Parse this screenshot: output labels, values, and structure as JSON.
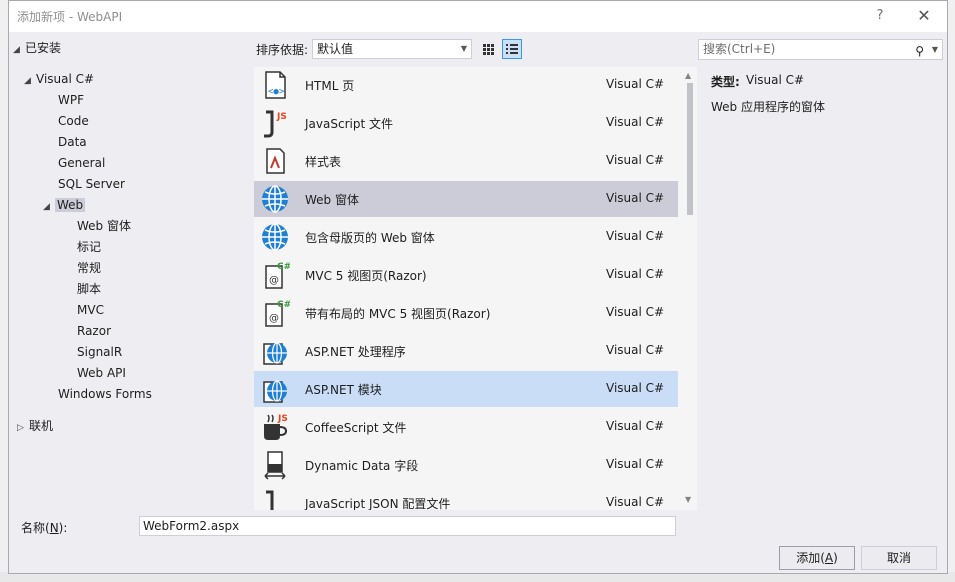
{
  "window": {
    "title": "添加新项 - WebAPI",
    "help_glyph": "?",
    "close_glyph": "✕"
  },
  "tree": {
    "installed": "已安装",
    "visual_csharp": "Visual C#",
    "children": [
      "WPF",
      "Code",
      "Data",
      "General",
      "SQL Server"
    ],
    "web": "Web",
    "web_children": [
      "Web 窗体",
      "标记",
      "常规",
      "脚本",
      "MVC",
      "Razor",
      "SignalR",
      "Web API"
    ],
    "windows_forms": "Windows Forms",
    "online": "联机"
  },
  "toolbar": {
    "sort_label": "排序依据:",
    "sort_value": "默认值"
  },
  "templates": [
    {
      "name": "HTML 页",
      "lang": "Visual C#",
      "icon": "html-page-icon"
    },
    {
      "name": "JavaScript 文件",
      "lang": "Visual C#",
      "icon": "javascript-file-icon"
    },
    {
      "name": "样式表",
      "lang": "Visual C#",
      "icon": "stylesheet-icon"
    },
    {
      "name": "Web 窗体",
      "lang": "Visual C#",
      "icon": "globe-icon"
    },
    {
      "name": "包含母版页的 Web 窗体",
      "lang": "Visual C#",
      "icon": "globe-icon"
    },
    {
      "name": "MVC 5 视图页(Razor)",
      "lang": "Visual C#",
      "icon": "razor-view-icon"
    },
    {
      "name": "带有布局的 MVC 5 视图页(Razor)",
      "lang": "Visual C#",
      "icon": "razor-view-icon"
    },
    {
      "name": "ASP.NET 处理程序",
      "lang": "Visual C#",
      "icon": "globe-doc-icon"
    },
    {
      "name": "ASP.NET 模块",
      "lang": "Visual C#",
      "icon": "globe-doc-icon"
    },
    {
      "name": "CoffeeScript 文件",
      "lang": "Visual C#",
      "icon": "coffeescript-icon"
    },
    {
      "name": "Dynamic Data 字段",
      "lang": "Visual C#",
      "icon": "dynamic-data-icon"
    },
    {
      "name": "JavaScript JSON 配置文件",
      "lang": "Visual C#",
      "icon": "json-config-icon"
    }
  ],
  "search": {
    "placeholder": "搜索(Ctrl+E)"
  },
  "details": {
    "type_label": "类型:",
    "type_value": "Visual C#",
    "description": "Web 应用程序的窗体"
  },
  "name_field": {
    "label_prefix": "名称(",
    "label_key": "N",
    "label_suffix": "):",
    "value": "WebForm2.aspx"
  },
  "buttons": {
    "add_prefix": "添加(",
    "add_key": "A",
    "add_suffix": ")",
    "cancel": "取消"
  },
  "colors": {
    "selected_grey": "#ccccd8",
    "selected_blue": "#c9ddf6",
    "accent": "#3399ff",
    "globe": "#1e7fd4"
  }
}
